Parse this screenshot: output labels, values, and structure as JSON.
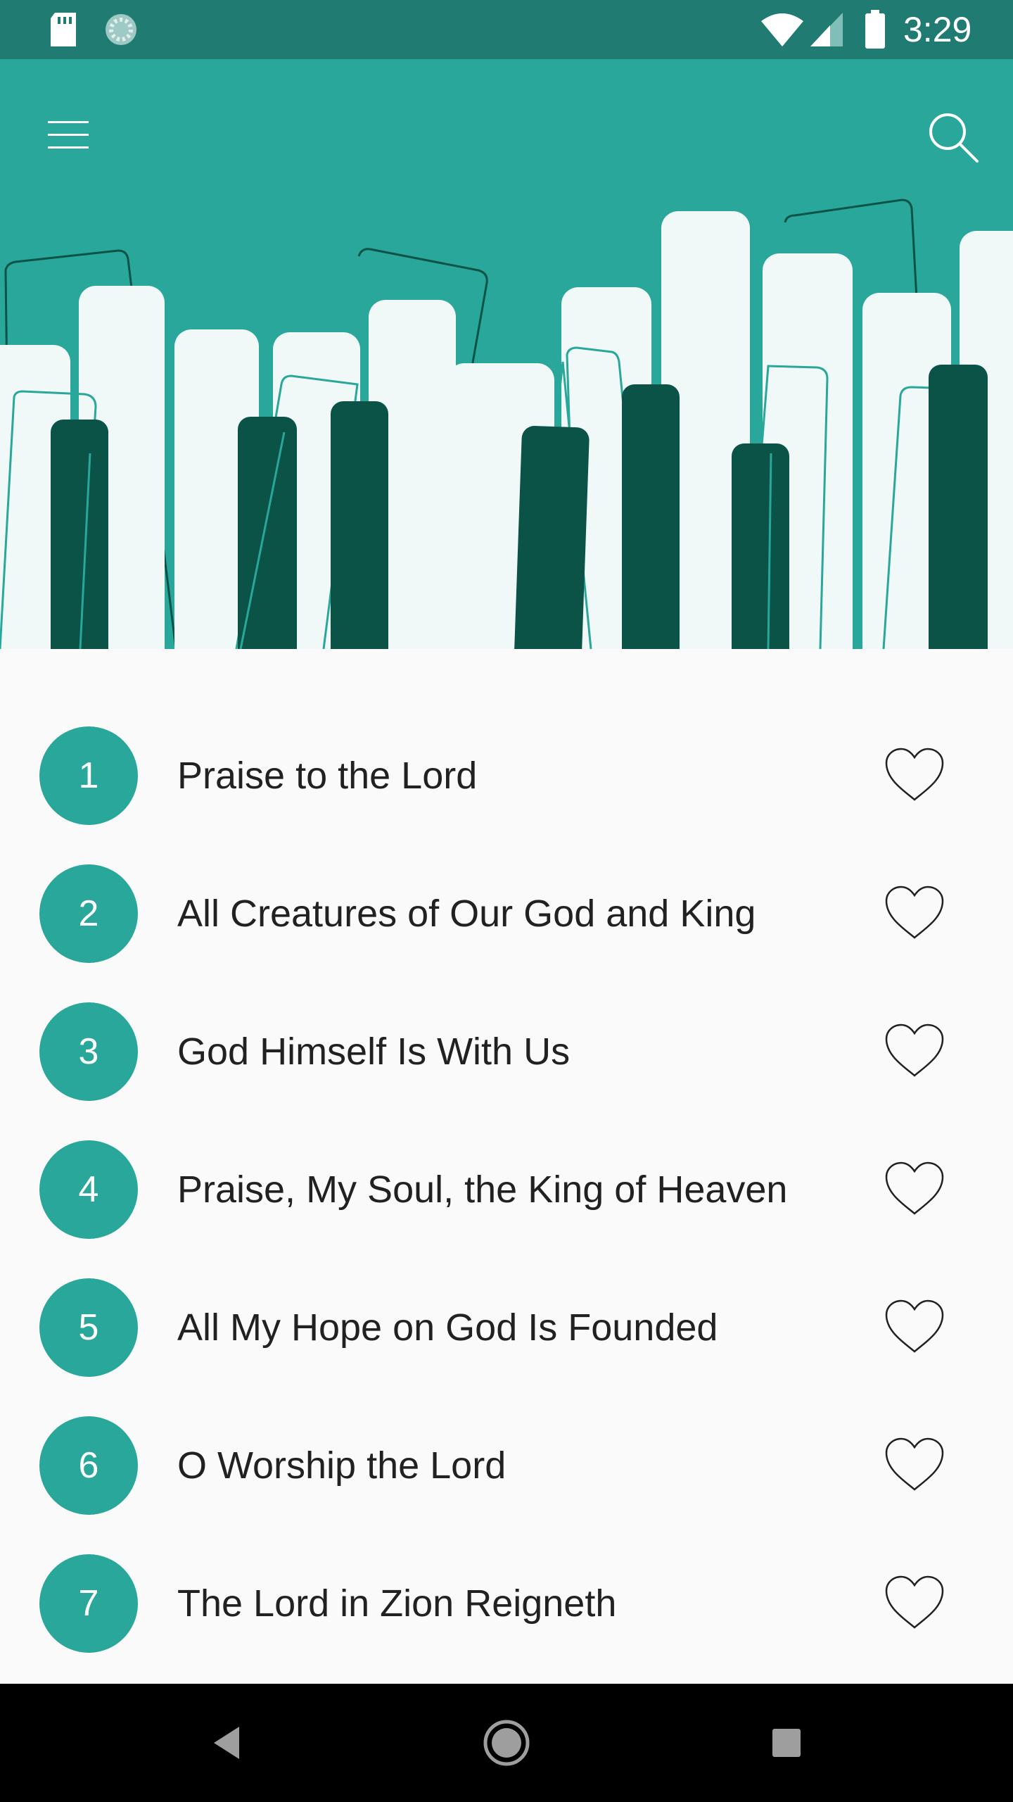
{
  "status_bar": {
    "time": "3:29",
    "icons": [
      "sd-card-icon",
      "sync-icon",
      "wifi-icon",
      "signal-icon",
      "battery-icon"
    ]
  },
  "toolbar": {
    "menu_icon": "hamburger-menu-icon",
    "search_icon": "search-icon"
  },
  "colors": {
    "status_bar": "#207b72",
    "primary": "#29a79a",
    "dark_key": "#0b5247",
    "light_key": "#f0f9f7",
    "background": "#fafafa",
    "text": "#212121"
  },
  "hymns": [
    {
      "number": "1",
      "title": "Praise to the Lord"
    },
    {
      "number": "2",
      "title": "All Creatures of Our God and King"
    },
    {
      "number": "3",
      "title": "God Himself Is With Us"
    },
    {
      "number": "4",
      "title": "Praise, My Soul, the King of Heaven"
    },
    {
      "number": "5",
      "title": "All My Hope on God Is Founded"
    },
    {
      "number": "6",
      "title": "O Worship the Lord"
    },
    {
      "number": "7",
      "title": "The Lord in Zion Reigneth"
    }
  ],
  "nav": {
    "back_icon": "back-triangle-icon",
    "home_icon": "home-circle-icon",
    "recents_icon": "recents-square-icon"
  }
}
